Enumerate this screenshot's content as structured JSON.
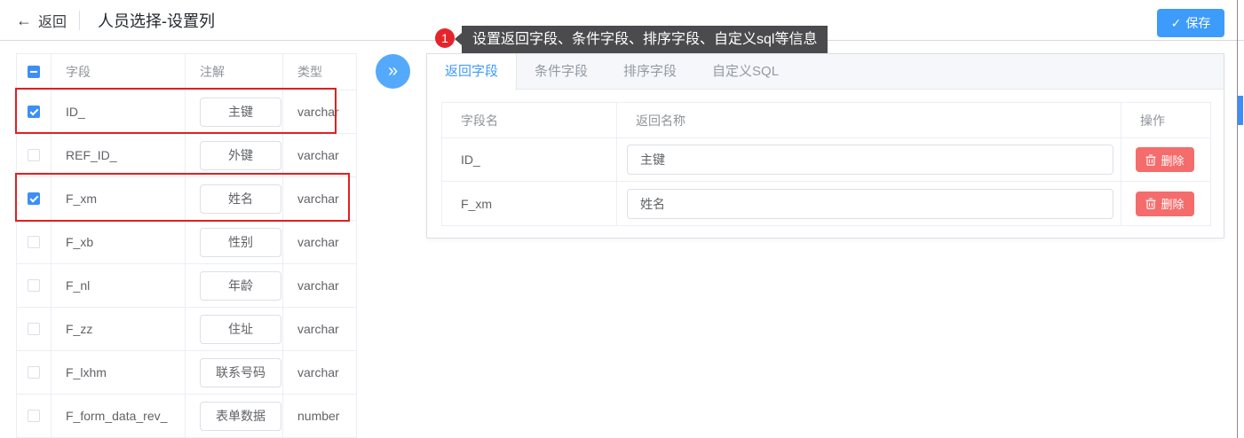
{
  "header": {
    "back_icon": "←",
    "back_label": "返回",
    "title": "人员选择-设置列",
    "save_icon": "✓",
    "save_label": "保存"
  },
  "annotation": {
    "badge": "1",
    "tooltip": "设置返回字段、条件字段、排序字段、自定义sql等信息"
  },
  "collapse_button": {
    "icon": "»"
  },
  "left_table": {
    "select_all_state": "indeterminate",
    "columns": {
      "field": "字段",
      "comment": "注解",
      "type": "类型"
    },
    "rows": [
      {
        "field": "ID_",
        "comment": "主键",
        "type": "varchar",
        "checked": true,
        "highlighted": true
      },
      {
        "field": "REF_ID_",
        "comment": "外键",
        "type": "varchar",
        "checked": false,
        "highlighted": false
      },
      {
        "field": "F_xm",
        "comment": "姓名",
        "type": "varchar",
        "checked": true,
        "highlighted": true
      },
      {
        "field": "F_xb",
        "comment": "性别",
        "type": "varchar",
        "checked": false,
        "highlighted": false
      },
      {
        "field": "F_nl",
        "comment": "年龄",
        "type": "varchar",
        "checked": false,
        "highlighted": false
      },
      {
        "field": "F_zz",
        "comment": "住址",
        "type": "varchar",
        "checked": false,
        "highlighted": false
      },
      {
        "field": "F_lxhm",
        "comment": "联系号码",
        "type": "varchar",
        "checked": false,
        "highlighted": false
      },
      {
        "field": "F_form_data_rev_",
        "comment": "表单数据",
        "type": "number",
        "checked": false,
        "highlighted": false
      }
    ]
  },
  "tabs": [
    {
      "label": "返回字段",
      "active": true
    },
    {
      "label": "条件字段",
      "active": false
    },
    {
      "label": "排序字段",
      "active": false
    },
    {
      "label": "自定义SQL",
      "active": false
    }
  ],
  "right_table": {
    "columns": {
      "field": "字段名",
      "return_name": "返回名称",
      "action": "操作"
    },
    "rows": [
      {
        "field": "ID_",
        "return_name": "主键",
        "action": "删除"
      },
      {
        "field": "F_xm",
        "return_name": "姓名",
        "action": "删除"
      }
    ]
  },
  "colors": {
    "accent": "#3d9bfb",
    "danger": "#f56c6c",
    "annotation_red": "#e02020",
    "tooltip_bg": "#4b4b4d",
    "badge_red": "#e6252b"
  }
}
